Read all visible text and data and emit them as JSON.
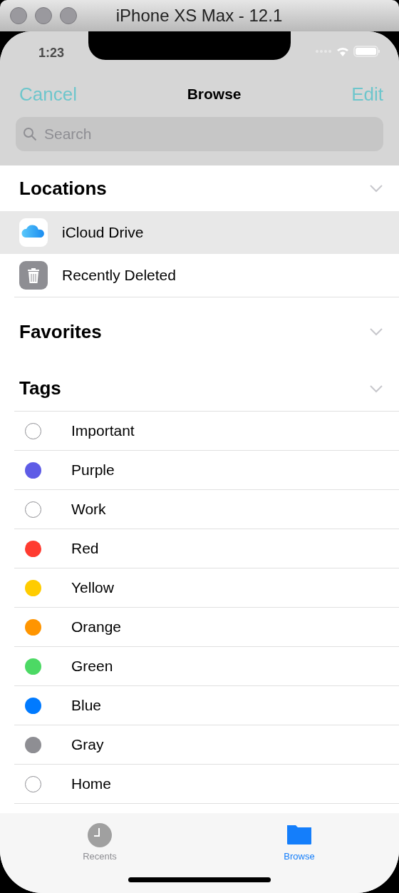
{
  "window": {
    "title": "iPhone XS Max - 12.1"
  },
  "status_bar": {
    "time": "1:23"
  },
  "nav": {
    "left": "Cancel",
    "title": "Browse",
    "right": "Edit"
  },
  "search": {
    "placeholder": "Search"
  },
  "sections": [
    {
      "title": "Locations",
      "expanded": true,
      "items": [
        {
          "label": "iCloud Drive",
          "kind": "cloud",
          "selected": true
        },
        {
          "label": "Recently Deleted",
          "kind": "trash",
          "selected": false
        }
      ]
    },
    {
      "title": "Favorites",
      "expanded": true
    },
    {
      "title": "Tags",
      "expanded": true,
      "items": [
        {
          "label": "Important",
          "kind": "outline"
        },
        {
          "label": "Purple",
          "kind": "dot",
          "color": "#5e5ce6"
        },
        {
          "label": "Work",
          "kind": "outline"
        },
        {
          "label": "Red",
          "kind": "dot",
          "color": "#ff3b30"
        },
        {
          "label": "Yellow",
          "kind": "dot",
          "color": "#ffcc00"
        },
        {
          "label": "Orange",
          "kind": "dot",
          "color": "#ff9500"
        },
        {
          "label": "Green",
          "kind": "dot",
          "color": "#4cd964"
        },
        {
          "label": "Blue",
          "kind": "dot",
          "color": "#007aff"
        },
        {
          "label": "Gray",
          "kind": "dot",
          "color": "#8e8e93"
        },
        {
          "label": "Home",
          "kind": "outline"
        }
      ]
    }
  ],
  "tab_bar": [
    {
      "label": "Recents",
      "kind": "clock",
      "selected": false
    },
    {
      "label": "Browse",
      "kind": "folder",
      "selected": true
    }
  ]
}
